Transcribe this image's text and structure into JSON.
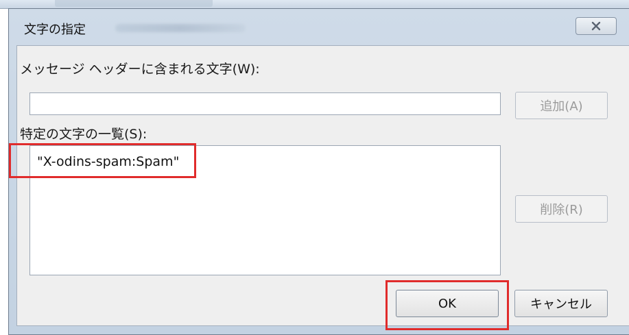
{
  "dialog": {
    "title": "文字の指定",
    "close_icon": "close-icon"
  },
  "header_chars": {
    "label": "メッセージ ヘッダーに含まれる文字(W):",
    "value": "",
    "add_label": "追加(A)"
  },
  "char_list": {
    "label": "特定の文字の一覧(S):",
    "items": [
      "\"X-odins-spam:Spam\""
    ],
    "delete_label": "削除(R)"
  },
  "footer": {
    "ok_label": "OK",
    "cancel_label": "キャンセル"
  },
  "colors": {
    "highlight": "#e02b2b",
    "dialog_frame": "#c3d2e2"
  }
}
